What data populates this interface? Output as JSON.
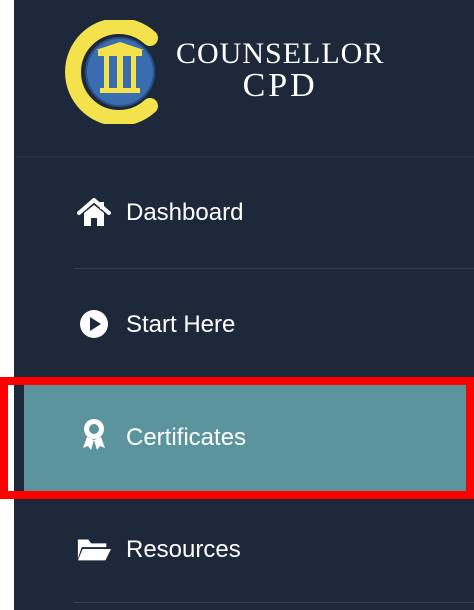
{
  "brand": {
    "line1": "COUNSELLOR",
    "line2": "CPD",
    "logo_icon": "counsellor-cpd-logo"
  },
  "nav": {
    "items": [
      {
        "label": "Dashboard",
        "icon": "home-icon"
      },
      {
        "label": "Start Here",
        "icon": "play-circle-icon"
      },
      {
        "label": "Certificates",
        "icon": "award-icon",
        "active": true
      },
      {
        "label": "Resources",
        "icon": "folder-open-icon"
      }
    ]
  },
  "colors": {
    "sidebar_bg": "#1d283a",
    "active_bg": "#5c949e",
    "highlight_border": "#ff0000",
    "logo_gold": "#f4e24c",
    "logo_blue": "#3a6db0"
  }
}
